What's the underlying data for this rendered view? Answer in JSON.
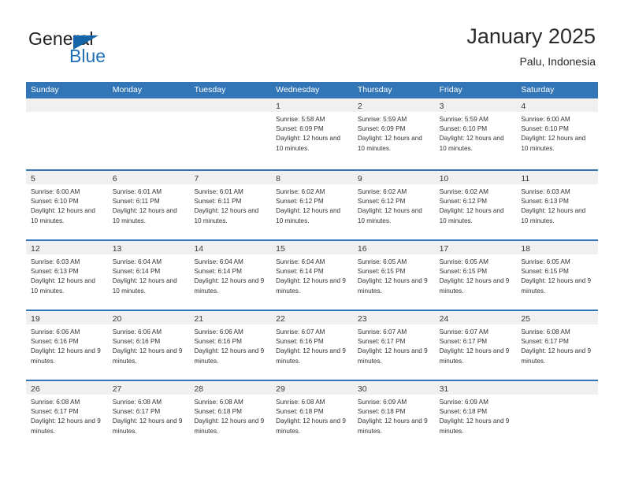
{
  "brand": {
    "word1": "General",
    "word2": "Blue",
    "accent_color": "#1364a8",
    "triangle_icon": "brand-triangle-icon"
  },
  "header": {
    "title": "January 2025",
    "location": "Palu, Indonesia"
  },
  "theme": {
    "header_blue": "#3376b8",
    "daynum_band": "#f0f0f0",
    "text": "#333333"
  },
  "weekday_headers": [
    "Sunday",
    "Monday",
    "Tuesday",
    "Wednesday",
    "Thursday",
    "Friday",
    "Saturday"
  ],
  "weeks": [
    [
      {
        "day": "",
        "sunrise": "",
        "sunset": "",
        "daylight": "",
        "empty": true
      },
      {
        "day": "",
        "sunrise": "",
        "sunset": "",
        "daylight": "",
        "empty": true
      },
      {
        "day": "",
        "sunrise": "",
        "sunset": "",
        "daylight": "",
        "empty": true
      },
      {
        "day": "1",
        "sunrise": "Sunrise: 5:58 AM",
        "sunset": "Sunset: 6:09 PM",
        "daylight": "Daylight: 12 hours and 10 minutes."
      },
      {
        "day": "2",
        "sunrise": "Sunrise: 5:59 AM",
        "sunset": "Sunset: 6:09 PM",
        "daylight": "Daylight: 12 hours and 10 minutes."
      },
      {
        "day": "3",
        "sunrise": "Sunrise: 5:59 AM",
        "sunset": "Sunset: 6:10 PM",
        "daylight": "Daylight: 12 hours and 10 minutes."
      },
      {
        "day": "4",
        "sunrise": "Sunrise: 6:00 AM",
        "sunset": "Sunset: 6:10 PM",
        "daylight": "Daylight: 12 hours and 10 minutes."
      }
    ],
    [
      {
        "day": "5",
        "sunrise": "Sunrise: 6:00 AM",
        "sunset": "Sunset: 6:10 PM",
        "daylight": "Daylight: 12 hours and 10 minutes."
      },
      {
        "day": "6",
        "sunrise": "Sunrise: 6:01 AM",
        "sunset": "Sunset: 6:11 PM",
        "daylight": "Daylight: 12 hours and 10 minutes."
      },
      {
        "day": "7",
        "sunrise": "Sunrise: 6:01 AM",
        "sunset": "Sunset: 6:11 PM",
        "daylight": "Daylight: 12 hours and 10 minutes."
      },
      {
        "day": "8",
        "sunrise": "Sunrise: 6:02 AM",
        "sunset": "Sunset: 6:12 PM",
        "daylight": "Daylight: 12 hours and 10 minutes."
      },
      {
        "day": "9",
        "sunrise": "Sunrise: 6:02 AM",
        "sunset": "Sunset: 6:12 PM",
        "daylight": "Daylight: 12 hours and 10 minutes."
      },
      {
        "day": "10",
        "sunrise": "Sunrise: 6:02 AM",
        "sunset": "Sunset: 6:12 PM",
        "daylight": "Daylight: 12 hours and 10 minutes."
      },
      {
        "day": "11",
        "sunrise": "Sunrise: 6:03 AM",
        "sunset": "Sunset: 6:13 PM",
        "daylight": "Daylight: 12 hours and 10 minutes."
      }
    ],
    [
      {
        "day": "12",
        "sunrise": "Sunrise: 6:03 AM",
        "sunset": "Sunset: 6:13 PM",
        "daylight": "Daylight: 12 hours and 10 minutes."
      },
      {
        "day": "13",
        "sunrise": "Sunrise: 6:04 AM",
        "sunset": "Sunset: 6:14 PM",
        "daylight": "Daylight: 12 hours and 10 minutes."
      },
      {
        "day": "14",
        "sunrise": "Sunrise: 6:04 AM",
        "sunset": "Sunset: 6:14 PM",
        "daylight": "Daylight: 12 hours and 9 minutes."
      },
      {
        "day": "15",
        "sunrise": "Sunrise: 6:04 AM",
        "sunset": "Sunset: 6:14 PM",
        "daylight": "Daylight: 12 hours and 9 minutes."
      },
      {
        "day": "16",
        "sunrise": "Sunrise: 6:05 AM",
        "sunset": "Sunset: 6:15 PM",
        "daylight": "Daylight: 12 hours and 9 minutes."
      },
      {
        "day": "17",
        "sunrise": "Sunrise: 6:05 AM",
        "sunset": "Sunset: 6:15 PM",
        "daylight": "Daylight: 12 hours and 9 minutes."
      },
      {
        "day": "18",
        "sunrise": "Sunrise: 6:05 AM",
        "sunset": "Sunset: 6:15 PM",
        "daylight": "Daylight: 12 hours and 9 minutes."
      }
    ],
    [
      {
        "day": "19",
        "sunrise": "Sunrise: 6:06 AM",
        "sunset": "Sunset: 6:16 PM",
        "daylight": "Daylight: 12 hours and 9 minutes."
      },
      {
        "day": "20",
        "sunrise": "Sunrise: 6:06 AM",
        "sunset": "Sunset: 6:16 PM",
        "daylight": "Daylight: 12 hours and 9 minutes."
      },
      {
        "day": "21",
        "sunrise": "Sunrise: 6:06 AM",
        "sunset": "Sunset: 6:16 PM",
        "daylight": "Daylight: 12 hours and 9 minutes."
      },
      {
        "day": "22",
        "sunrise": "Sunrise: 6:07 AM",
        "sunset": "Sunset: 6:16 PM",
        "daylight": "Daylight: 12 hours and 9 minutes."
      },
      {
        "day": "23",
        "sunrise": "Sunrise: 6:07 AM",
        "sunset": "Sunset: 6:17 PM",
        "daylight": "Daylight: 12 hours and 9 minutes."
      },
      {
        "day": "24",
        "sunrise": "Sunrise: 6:07 AM",
        "sunset": "Sunset: 6:17 PM",
        "daylight": "Daylight: 12 hours and 9 minutes."
      },
      {
        "day": "25",
        "sunrise": "Sunrise: 6:08 AM",
        "sunset": "Sunset: 6:17 PM",
        "daylight": "Daylight: 12 hours and 9 minutes."
      }
    ],
    [
      {
        "day": "26",
        "sunrise": "Sunrise: 6:08 AM",
        "sunset": "Sunset: 6:17 PM",
        "daylight": "Daylight: 12 hours and 9 minutes."
      },
      {
        "day": "27",
        "sunrise": "Sunrise: 6:08 AM",
        "sunset": "Sunset: 6:17 PM",
        "daylight": "Daylight: 12 hours and 9 minutes."
      },
      {
        "day": "28",
        "sunrise": "Sunrise: 6:08 AM",
        "sunset": "Sunset: 6:18 PM",
        "daylight": "Daylight: 12 hours and 9 minutes."
      },
      {
        "day": "29",
        "sunrise": "Sunrise: 6:08 AM",
        "sunset": "Sunset: 6:18 PM",
        "daylight": "Daylight: 12 hours and 9 minutes."
      },
      {
        "day": "30",
        "sunrise": "Sunrise: 6:09 AM",
        "sunset": "Sunset: 6:18 PM",
        "daylight": "Daylight: 12 hours and 9 minutes."
      },
      {
        "day": "31",
        "sunrise": "Sunrise: 6:09 AM",
        "sunset": "Sunset: 6:18 PM",
        "daylight": "Daylight: 12 hours and 9 minutes."
      },
      {
        "day": "",
        "sunrise": "",
        "sunset": "",
        "daylight": "",
        "empty": true
      }
    ]
  ]
}
